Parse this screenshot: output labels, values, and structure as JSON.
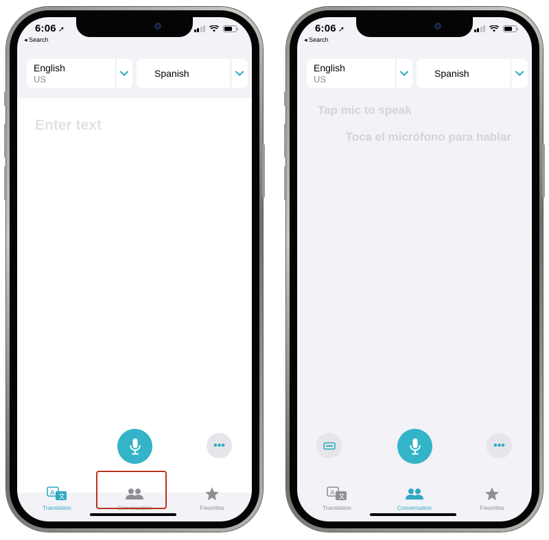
{
  "status_bar": {
    "time": "6:06",
    "back_label": "◂ Search"
  },
  "language_picker": {
    "source_name": "English",
    "source_region": "US",
    "target_name": "Spanish"
  },
  "translation_screen": {
    "placeholder": "Enter text"
  },
  "conversation_screen": {
    "hint_source": "Tap mic to speak",
    "hint_target": "Toca el micrófono para hablar"
  },
  "tabs": [
    {
      "label": "Translation",
      "icon": "translate-icon"
    },
    {
      "label": "Conversation",
      "icon": "people-icon"
    },
    {
      "label": "Favorites",
      "icon": "star-icon"
    }
  ],
  "more_label": "•••",
  "colors": {
    "accent": "#2ea9c1",
    "mic": "#34b4c8",
    "highlight": "#b8321b",
    "background": "#f2f2f7"
  },
  "left_phone": {
    "active_tab": "Translation",
    "highlighted_tab": "Conversation"
  },
  "right_phone": {
    "active_tab": "Conversation"
  }
}
